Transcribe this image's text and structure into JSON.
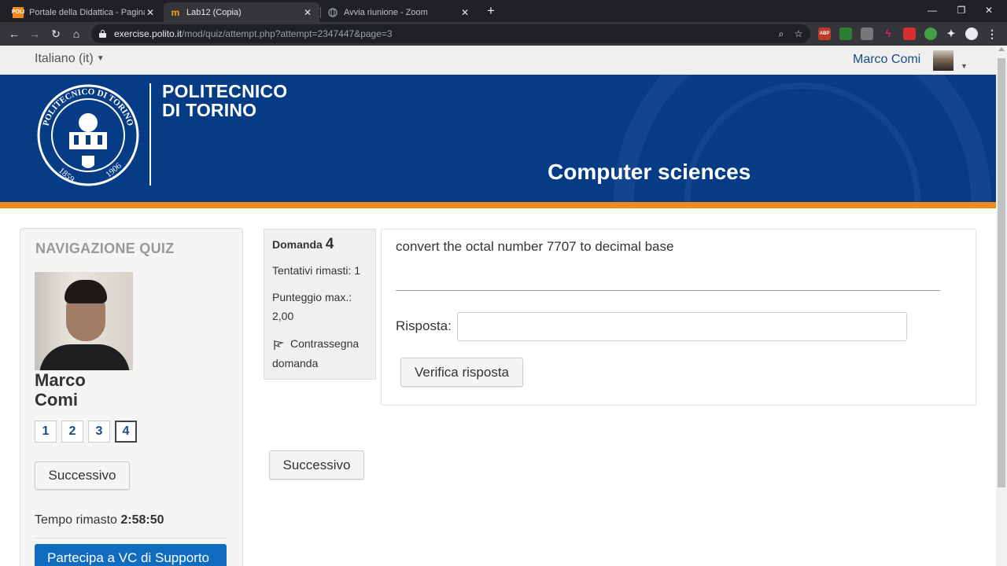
{
  "browser": {
    "tabs": [
      {
        "title": "Portale della Didattica - Pagina di",
        "favicon_text": "POLI",
        "favicon_color": "#f08a1e"
      },
      {
        "title": "Lab12 (Copia)",
        "favicon_text": "m",
        "favicon_color": "#f4a01b"
      },
      {
        "title": "Avvia riunione - Zoom",
        "favicon_text": "",
        "favicon_color": "#9aa0a6"
      }
    ],
    "url": {
      "domain": "exercise.polito.it",
      "path": "/mod/quiz/attempt.php?attempt=2347447&page=3"
    },
    "extensions": [
      "ABP",
      "green-ext",
      "gray-ext",
      "pink-ext",
      "red-ext",
      "mail-ext",
      "puzzle",
      "avatar"
    ]
  },
  "header": {
    "language": "Italiano (it)",
    "user_name": "Marco Comi"
  },
  "banner": {
    "logo_line1": "POLITECNICO",
    "logo_line2": "DI TORINO",
    "seal_top": "POLITECNICO DI TORINO",
    "seal_year_left": "1859",
    "seal_year_right": "1906",
    "course_title": "Computer sciences",
    "accent_color": "#f08a1e",
    "brand_color": "#063b85"
  },
  "quiz_nav": {
    "title": "NAVIGAZIONE QUIZ",
    "student_first": "Marco",
    "student_last": "Comi",
    "questions": [
      "1",
      "2",
      "3",
      "4"
    ],
    "current_question": "4",
    "next_label": "Successivo",
    "timer_label": "Tempo rimasto",
    "timer_value": "2:58:50",
    "vc_label": "Partecipa a VC di Supporto"
  },
  "question": {
    "label": "Domanda",
    "number": "4",
    "attempts": "Tentativi rimasti: 1",
    "max_score_label": "Punteggio max.:",
    "max_score_value": "2,00",
    "flag_label_1": "Contrassegna",
    "flag_label_2": "domanda",
    "text": "convert the octal number 7707 to decimal base",
    "answer_label": "Risposta:",
    "answer_value": "",
    "check_label": "Verifica risposta",
    "next_label": "Successivo"
  }
}
